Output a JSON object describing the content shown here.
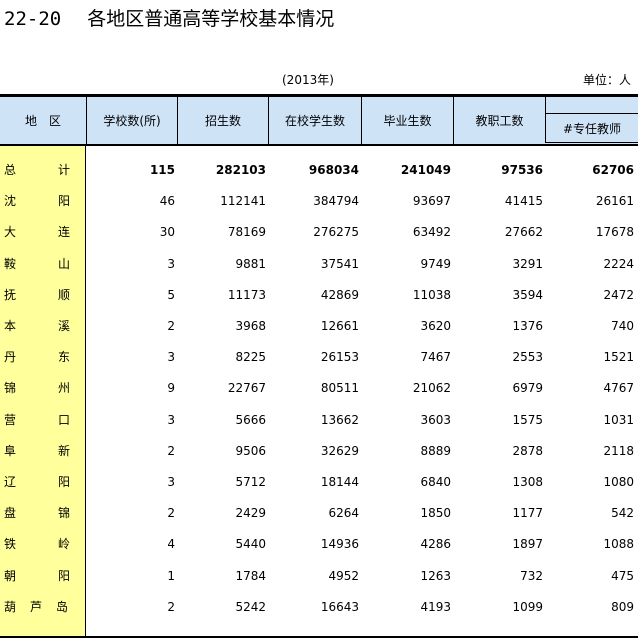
{
  "title": {
    "number": "22-20",
    "text": "各地区普通高等学校基本情况"
  },
  "year_note": "(2013年)",
  "unit_note": "单位：人",
  "headers": {
    "region": "地　区",
    "schools": "学校数(所)",
    "enrollment": "招生数",
    "students": "在校学生数",
    "graduates": "毕业生数",
    "staff": "教职工数",
    "teachers": "#专任教师"
  },
  "rows": [
    {
      "region": [
        "总",
        "计"
      ],
      "schools": "115",
      "enrollment": "282103",
      "students": "968034",
      "graduates": "241049",
      "staff": "97536",
      "teachers": "62706"
    },
    {
      "region": [
        "沈",
        "阳"
      ],
      "schools": "46",
      "enrollment": "112141",
      "students": "384794",
      "graduates": "93697",
      "staff": "41415",
      "teachers": "26161"
    },
    {
      "region": [
        "大",
        "连"
      ],
      "schools": "30",
      "enrollment": "78169",
      "students": "276275",
      "graduates": "63492",
      "staff": "27662",
      "teachers": "17678"
    },
    {
      "region": [
        "鞍",
        "山"
      ],
      "schools": "3",
      "enrollment": "9881",
      "students": "37541",
      "graduates": "9749",
      "staff": "3291",
      "teachers": "2224"
    },
    {
      "region": [
        "抚",
        "顺"
      ],
      "schools": "5",
      "enrollment": "11173",
      "students": "42869",
      "graduates": "11038",
      "staff": "3594",
      "teachers": "2472"
    },
    {
      "region": [
        "本",
        "溪"
      ],
      "schools": "2",
      "enrollment": "3968",
      "students": "12661",
      "graduates": "3620",
      "staff": "1376",
      "teachers": "740"
    },
    {
      "region": [
        "丹",
        "东"
      ],
      "schools": "3",
      "enrollment": "8225",
      "students": "26153",
      "graduates": "7467",
      "staff": "2553",
      "teachers": "1521"
    },
    {
      "region": [
        "锦",
        "州"
      ],
      "schools": "9",
      "enrollment": "22767",
      "students": "80511",
      "graduates": "21062",
      "staff": "6979",
      "teachers": "4767"
    },
    {
      "region": [
        "营",
        "口"
      ],
      "schools": "3",
      "enrollment": "5666",
      "students": "13662",
      "graduates": "3603",
      "staff": "1575",
      "teachers": "1031"
    },
    {
      "region": [
        "阜",
        "新"
      ],
      "schools": "2",
      "enrollment": "9506",
      "students": "32629",
      "graduates": "8889",
      "staff": "2878",
      "teachers": "2118"
    },
    {
      "region": [
        "辽",
        "阳"
      ],
      "schools": "3",
      "enrollment": "5712",
      "students": "18144",
      "graduates": "6840",
      "staff": "1308",
      "teachers": "1080"
    },
    {
      "region": [
        "盘",
        "锦"
      ],
      "schools": "2",
      "enrollment": "2429",
      "students": "6264",
      "graduates": "1850",
      "staff": "1177",
      "teachers": "542"
    },
    {
      "region": [
        "铁",
        "岭"
      ],
      "schools": "4",
      "enrollment": "5440",
      "students": "14936",
      "graduates": "4286",
      "staff": "1897",
      "teachers": "1088"
    },
    {
      "region": [
        "朝",
        "阳"
      ],
      "schools": "1",
      "enrollment": "1784",
      "students": "4952",
      "graduates": "1263",
      "staff": "732",
      "teachers": "475"
    },
    {
      "region": [
        "葫",
        "芦",
        "岛"
      ],
      "schools": "2",
      "enrollment": "5242",
      "students": "16643",
      "graduates": "4193",
      "staff": "1099",
      "teachers": "809"
    }
  ]
}
